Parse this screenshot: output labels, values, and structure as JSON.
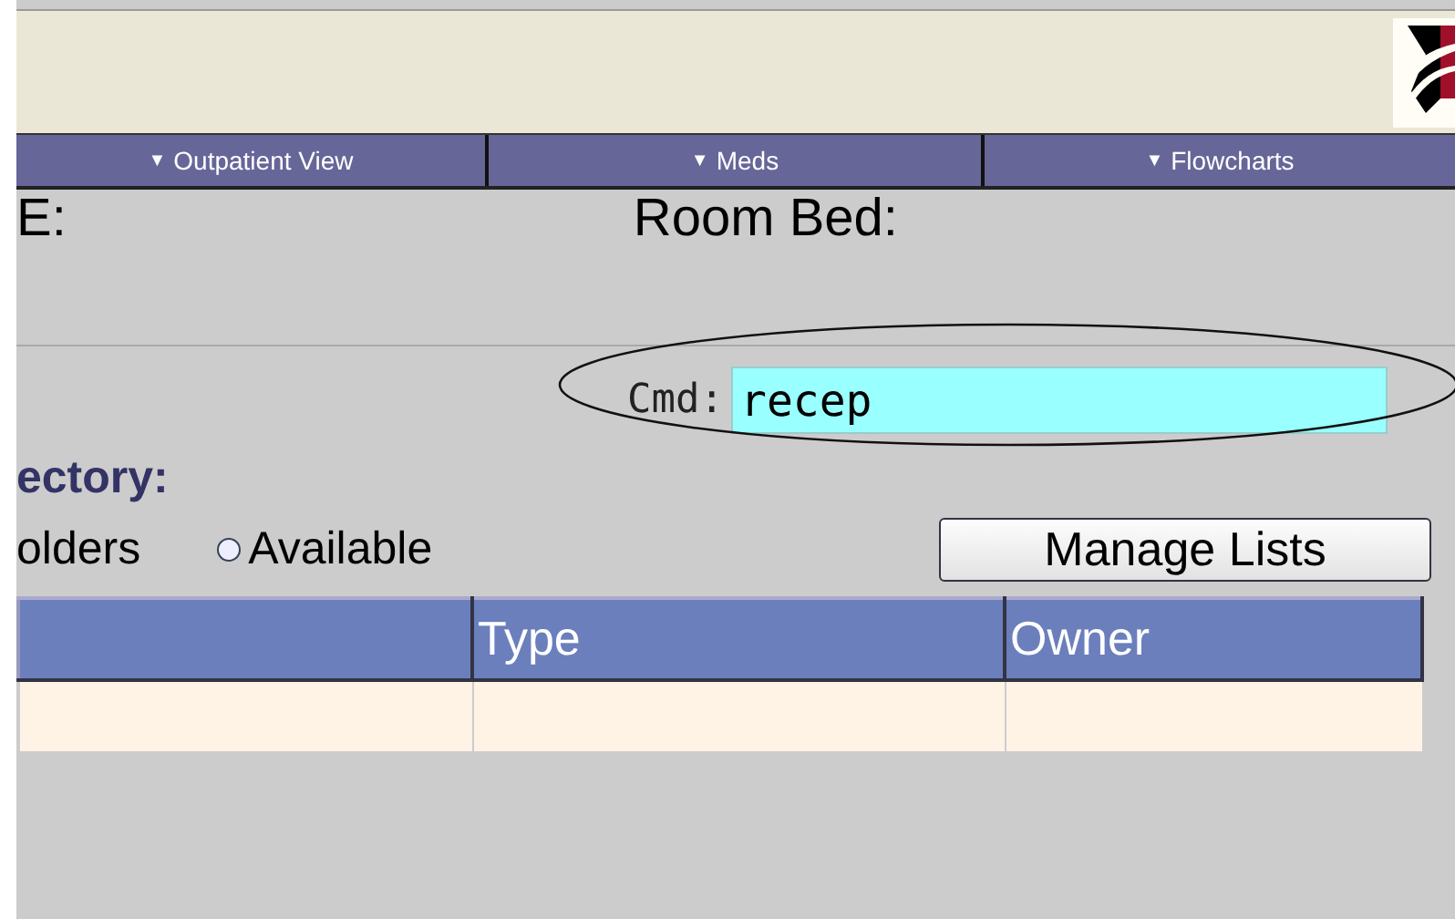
{
  "nav_tabs": [
    {
      "label": "Outpatient View",
      "arrow": "▼"
    },
    {
      "label": "Meds",
      "arrow": "▼"
    },
    {
      "label": "Flowcharts",
      "arrow": "▼"
    }
  ],
  "header": {
    "left_label": "E:",
    "room_bed_label": "Room Bed:"
  },
  "command": {
    "label": "Cmd:",
    "value": "recep",
    "annotated": true
  },
  "section_title": "ectory:",
  "filter": {
    "left_label": "olders",
    "radio": {
      "label": "Available",
      "selected": false
    }
  },
  "manage_button": "Manage Lists",
  "table": {
    "columns": [
      "",
      "Type",
      "Owner"
    ],
    "rows": [
      [
        "",
        "",
        ""
      ]
    ]
  }
}
